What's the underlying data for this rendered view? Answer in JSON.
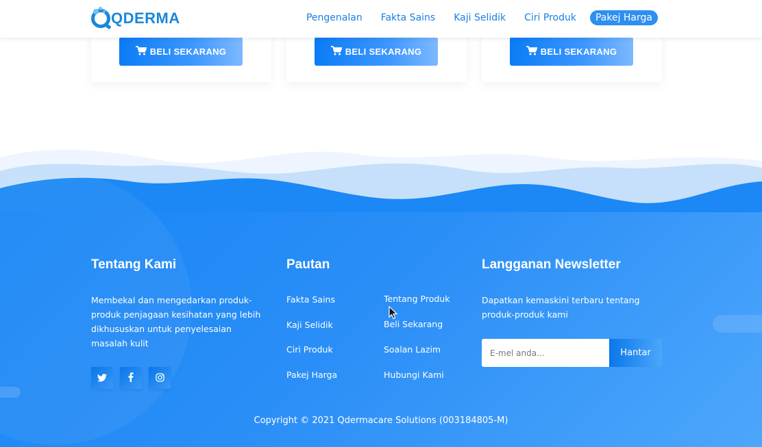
{
  "header": {
    "logo_text": "QDERMA",
    "nav": [
      {
        "label": "Pengenalan"
      },
      {
        "label": "Fakta Sains"
      },
      {
        "label": "Kaji Selidik"
      },
      {
        "label": "Ciri Produk"
      },
      {
        "label": "Pakej Harga",
        "active": true
      }
    ]
  },
  "cards": [
    {
      "button_label": "BELI SEKARANG",
      "icon": "cart-icon"
    },
    {
      "button_label": "BELI SEKARANG",
      "icon": "cart-icon"
    },
    {
      "button_label": "BELI SEKARANG",
      "icon": "cart-icon"
    }
  ],
  "footer": {
    "about": {
      "title": "Tentang Kami",
      "text": "Membekal dan mengedarkan produk-produk penjagaan kesihatan yang lebih dikhususkan untuk penyelesaian masalah kulit",
      "social": [
        {
          "icon": "twitter-icon"
        },
        {
          "icon": "facebook-icon"
        },
        {
          "icon": "instagram-icon"
        }
      ]
    },
    "links": {
      "title": "Pautan",
      "col1": [
        "Fakta Sains",
        "Kaji Selidik",
        "Ciri Produk",
        "Pakej Harga"
      ],
      "col2": [
        "Tentang Produk",
        "Beli Sekarang",
        "Soalan Lazim",
        "Hubungi Kami"
      ]
    },
    "newsletter": {
      "title": "Langganan Newsletter",
      "text": "Dapatkan kemaskini terbaru tentang produk-produk kami",
      "input_placeholder": "E-mel anda...",
      "button_label": "Hantar"
    },
    "copyright": "Copyright © 2021 Qdermacare Solutions (003184805-M)"
  },
  "colors": {
    "primary": "#1a87d9",
    "footer_start": "#1585f5",
    "footer_end": "#4da6fb"
  }
}
